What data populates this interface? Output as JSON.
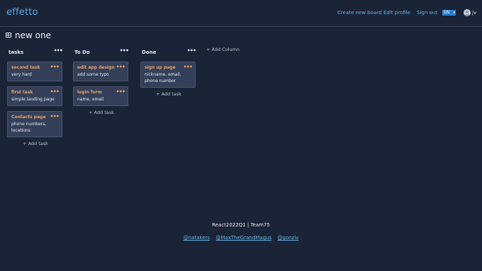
{
  "header": {
    "logo": "effetto",
    "create_board": "Create new board",
    "edit_profile": "Edit profile",
    "sign_out": "Sign out",
    "language": "EN",
    "user": "jv"
  },
  "board": {
    "title": "new one",
    "add_column": "+ Add Column",
    "columns": [
      {
        "title": "tasks",
        "add_task": "+ Add task",
        "cards": [
          {
            "title": "second task",
            "desc": "very hard"
          },
          {
            "title": "first task",
            "desc": "simple landing page"
          },
          {
            "title": "Contacts page",
            "desc": "phone numbers, locations"
          }
        ]
      },
      {
        "title": "To Do",
        "add_task": "+ Add task",
        "cards": [
          {
            "title": "edit app design",
            "desc": "add some typo"
          },
          {
            "title": "login form",
            "desc": "name, email"
          }
        ]
      },
      {
        "title": "Done",
        "add_task": "+ Add task",
        "cards": [
          {
            "title": "sign up page",
            "desc": "nickname, email, phone number"
          }
        ]
      }
    ]
  },
  "footer": {
    "team": "React2022Q1 | Team75",
    "links": [
      "@natakers",
      "@MaxTheGrandMagus",
      "@gonziv"
    ]
  },
  "colors": {
    "background": "#1b2436",
    "accent": "#5fb3ea",
    "card": "#34405a",
    "card_title": "#e8a064"
  }
}
